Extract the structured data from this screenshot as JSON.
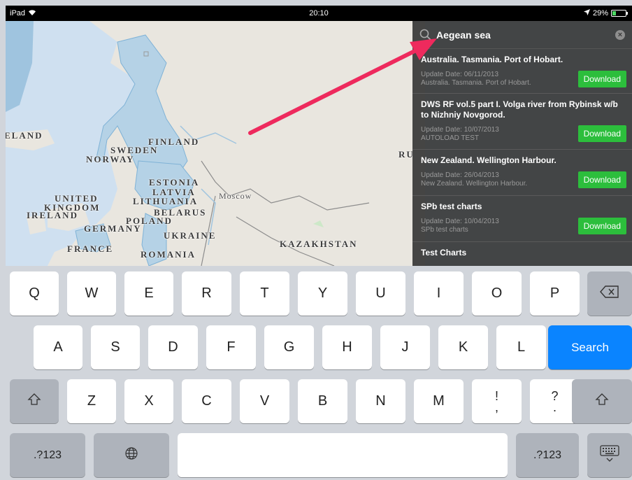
{
  "status_bar": {
    "device": "iPad",
    "time": "20:10",
    "battery_text": "29%",
    "battery_level": 0.29
  },
  "map": {
    "labels": {
      "iceland": "ELAND",
      "finland": "FINLAND",
      "sweden": "SWEDEN",
      "norway": "NORWAY",
      "estonia": "ESTONIA",
      "latvia": "LATVIA",
      "lithuania": "LITHUANIA",
      "united": "UNITED",
      "kingdom": "KINGDOM",
      "ireland": "IRELAND",
      "belarus": "BELARUS",
      "poland": "POLAND",
      "germany": "GERMANY",
      "ukraine": "UKRAINE",
      "france": "FRANCE",
      "romania": "ROMANIA",
      "kazakhstan": "KAZAKHSTAN",
      "moscow": "Moscow",
      "russia_partial": "RU"
    }
  },
  "search": {
    "value": "Aegean sea"
  },
  "results": [
    {
      "title": "Australia. Tasmania. Port of Hobart.",
      "date": "Update Date: 06/11/2013",
      "desc": "Australia. Tasmania. Port of Hobart.",
      "button": "Download"
    },
    {
      "title": "DWS RF vol.5 part I. Volga river from Rybinsk w/b to Nizhniy Novgorod.",
      "date": "Update Date: 10/07/2013",
      "desc": "AUTOLOAD TEST",
      "button": "Download"
    },
    {
      "title": "New Zealand. Wellington Harbour.",
      "date": "Update Date: 26/04/2013",
      "desc": "New Zealand. Wellington Harbour.",
      "button": "Download"
    },
    {
      "title": "SPb test charts",
      "date": "Update Date: 10/04/2013",
      "desc": "SPb test charts",
      "button": "Download"
    },
    {
      "title": "Test Charts",
      "date": "",
      "desc": "",
      "button": ""
    }
  ],
  "keyboard": {
    "row1": [
      "Q",
      "W",
      "E",
      "R",
      "T",
      "Y",
      "U",
      "I",
      "O",
      "P"
    ],
    "row2": [
      "A",
      "S",
      "D",
      "F",
      "G",
      "H",
      "J",
      "K",
      "L"
    ],
    "row3": [
      "Z",
      "X",
      "C",
      "V",
      "B",
      "N",
      "M"
    ],
    "exclaim_top": "!",
    "exclaim_bottom": ",",
    "question_top": "?",
    "question_bottom": ".",
    "search_label": "Search",
    "numbers_label": ".?123"
  },
  "colors": {
    "accent": "#0a84ff",
    "download": "#2cbe3c",
    "arrow": "#ee2a5d"
  }
}
